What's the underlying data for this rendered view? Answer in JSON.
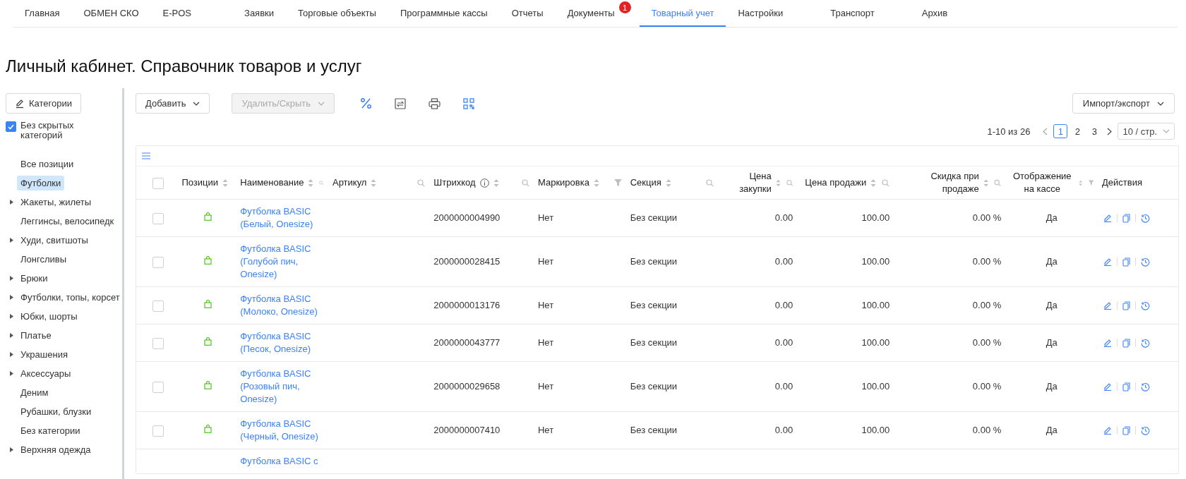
{
  "nav": {
    "tabs": [
      {
        "label": "Главная",
        "selected": false
      },
      {
        "label": "ОБМЕН СКО",
        "selected": false
      },
      {
        "label": "E-POS",
        "selected": false
      },
      {
        "label": "Заявки",
        "selected": false
      },
      {
        "label": "Торговые объекты",
        "selected": false
      },
      {
        "label": "Программные кассы",
        "selected": false
      },
      {
        "label": "Отчеты",
        "selected": false
      },
      {
        "label": "Документы",
        "selected": false,
        "badge": "1"
      },
      {
        "label": "Товарный учет",
        "selected": true
      },
      {
        "label": "Настройки",
        "selected": false
      },
      {
        "label": "Транспорт",
        "selected": false
      },
      {
        "label": "Архив",
        "selected": false
      }
    ]
  },
  "page_title": "Личный кабинет. Справочник товаров и услуг",
  "sidebar": {
    "categories_button": "Категории",
    "hide_hidden": {
      "label": "Без скрытых категорий",
      "checked": true
    },
    "items": [
      {
        "label": "Все позиции",
        "kind": "leaf",
        "selected": false
      },
      {
        "label": "Футболки",
        "kind": "leaf",
        "selected": true
      },
      {
        "label": "Жакеты, жилеты",
        "kind": "group",
        "selected": false
      },
      {
        "label": "Леггинсы, велосипедк",
        "kind": "leaf",
        "selected": false
      },
      {
        "label": "Худи, свитшоты",
        "kind": "group",
        "selected": false
      },
      {
        "label": "Лонгсливы",
        "kind": "leaf",
        "selected": false
      },
      {
        "label": "Брюки",
        "kind": "group",
        "selected": false
      },
      {
        "label": "Футболки, топы, корсет",
        "kind": "group",
        "selected": false
      },
      {
        "label": "Юбки, шорты",
        "kind": "group",
        "selected": false
      },
      {
        "label": "Платье",
        "kind": "group",
        "selected": false
      },
      {
        "label": "Украшения",
        "kind": "group",
        "selected": false
      },
      {
        "label": "Аксессуары",
        "kind": "group",
        "selected": false
      },
      {
        "label": "Деним",
        "kind": "leaf",
        "selected": false
      },
      {
        "label": "Рубашки, блузки",
        "kind": "leaf",
        "selected": false
      },
      {
        "label": "Без категории",
        "kind": "leaf",
        "selected": false
      },
      {
        "label": "Верхняя одежда",
        "kind": "group",
        "selected": false
      }
    ]
  },
  "toolbar": {
    "add_button": "Добавить",
    "delete_button": {
      "label": "Удалить/Скрыть",
      "disabled": true
    },
    "import_export_button": "Импорт/экспорт"
  },
  "pagination": {
    "range": "1-10 из 26",
    "pages": [
      {
        "label": "1",
        "selected": true
      },
      {
        "label": "2",
        "selected": false
      },
      {
        "label": "3",
        "selected": false
      }
    ],
    "page_size": "10 / стр."
  },
  "table": {
    "select_all": {
      "checked": false
    },
    "columns": [
      "Позиции",
      "Наименование",
      "Артикул",
      "Штрихкод",
      "Маркировка",
      "Секция",
      "Цена закупки",
      "Цена продажи",
      "Скидка при продаже",
      "Отображение на кассе",
      "Действия"
    ],
    "rows": [
      {
        "selected": false,
        "name": "Футболка BASIC (Белый, Onesize)",
        "barcode": "2000000004990",
        "marking": "Нет",
        "section": "Без секции",
        "purchase_price": "0.00",
        "sale_price": "100.00",
        "discount": "0.00 %",
        "show_at_register": "Да"
      },
      {
        "selected": false,
        "name": "Футболка BASIC (Голубой пич, Onesize)",
        "barcode": "2000000028415",
        "marking": "Нет",
        "section": "Без секции",
        "purchase_price": "0.00",
        "sale_price": "100.00",
        "discount": "0.00 %",
        "show_at_register": "Да"
      },
      {
        "selected": false,
        "name": "Футболка BASIC (Молоко, Onesize)",
        "barcode": "2000000013176",
        "marking": "Нет",
        "section": "Без секции",
        "purchase_price": "0.00",
        "sale_price": "100.00",
        "discount": "0.00 %",
        "show_at_register": "Да"
      },
      {
        "selected": false,
        "name": "Футболка BASIC (Песок, Onesize)",
        "barcode": "2000000043777",
        "marking": "Нет",
        "section": "Без секции",
        "purchase_price": "0.00",
        "sale_price": "100.00",
        "discount": "0.00 %",
        "show_at_register": "Да"
      },
      {
        "selected": false,
        "name": "Футболка BASIC (Розовый пич, Onesize)",
        "barcode": "2000000029658",
        "marking": "Нет",
        "section": "Без секции",
        "purchase_price": "0.00",
        "sale_price": "100.00",
        "discount": "0.00 %",
        "show_at_register": "Да"
      },
      {
        "selected": false,
        "name": "Футболка BASIC (Черный, Onesize)",
        "barcode": "2000000007410",
        "marking": "Нет",
        "section": "Без секции",
        "purchase_price": "0.00",
        "sale_price": "100.00",
        "discount": "0.00 %",
        "show_at_register": "Да"
      },
      {
        "name": "Футболка BASIC с"
      }
    ]
  }
}
